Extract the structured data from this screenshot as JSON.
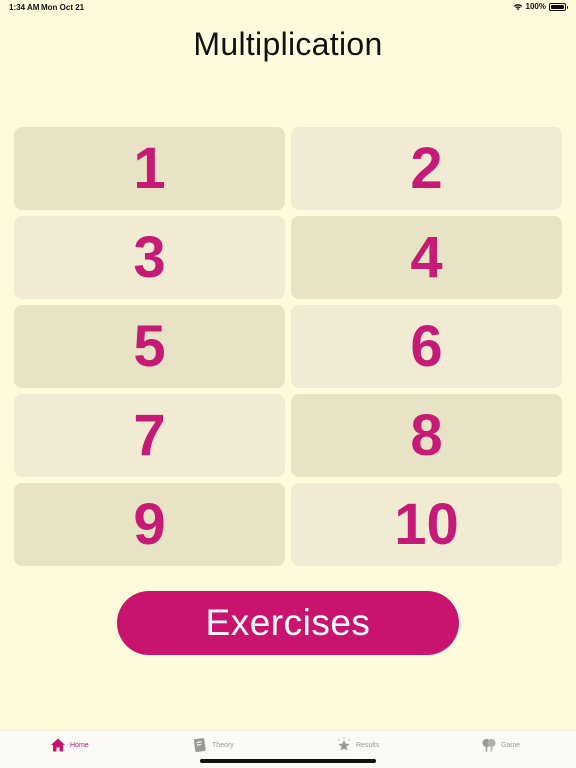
{
  "status": {
    "time": "1:34 AM",
    "date": "Mon Oct 21",
    "battery": "100%"
  },
  "title": "Multiplication",
  "tables": [
    "1",
    "2",
    "3",
    "4",
    "5",
    "6",
    "7",
    "8",
    "9",
    "10"
  ],
  "exercises_label": "Exercises",
  "tabs": {
    "home": "Home",
    "theory": "Theory",
    "results": "Results",
    "game": "Game"
  },
  "colors": {
    "background": "#fefbdc",
    "accent": "#c8146f",
    "tile_dark": "#e8e3c5",
    "tile_light": "#f0ebd2"
  }
}
